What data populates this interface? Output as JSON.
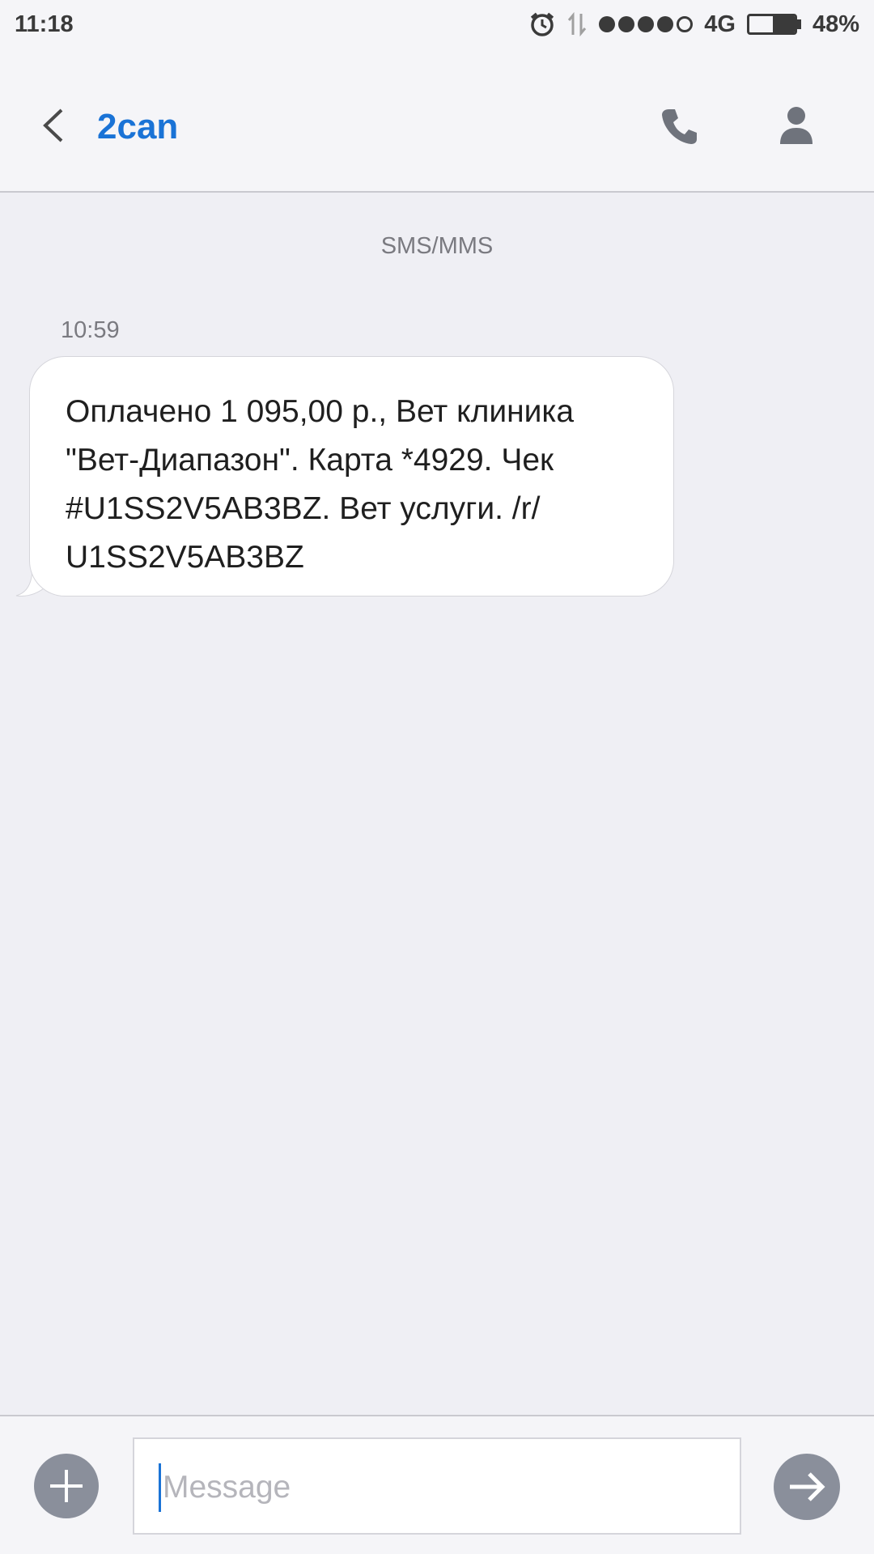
{
  "status_bar": {
    "time": "11:18",
    "network": "4G",
    "battery_percent": "48%",
    "battery_level": 0.48,
    "signal_bars": 4,
    "icons": [
      "alarm-icon",
      "data-transfer-icon",
      "signal-icon",
      "battery-icon"
    ]
  },
  "header": {
    "contact_name": "2can",
    "icons": [
      "back-arrow-icon",
      "phone-icon",
      "person-icon"
    ]
  },
  "thread": {
    "channel_label": "SMS/MMS",
    "messages": [
      {
        "time": "10:59",
        "lines": [
          "Оплачено  1 095,00 р., Вет клиника",
          "\"Вет-Диапазон\". Карта *4929. Чек",
          "#U1SS2V5AB3BZ. Вет услуги.  /r/",
          "U1SS2V5AB3BZ"
        ]
      }
    ]
  },
  "composer": {
    "placeholder": "Message",
    "icons": [
      "plus-icon",
      "send-arrow-icon"
    ]
  },
  "colors": {
    "accent": "#1a73d6",
    "background": "#efeff4",
    "button_gray": "#8a8f9b"
  }
}
